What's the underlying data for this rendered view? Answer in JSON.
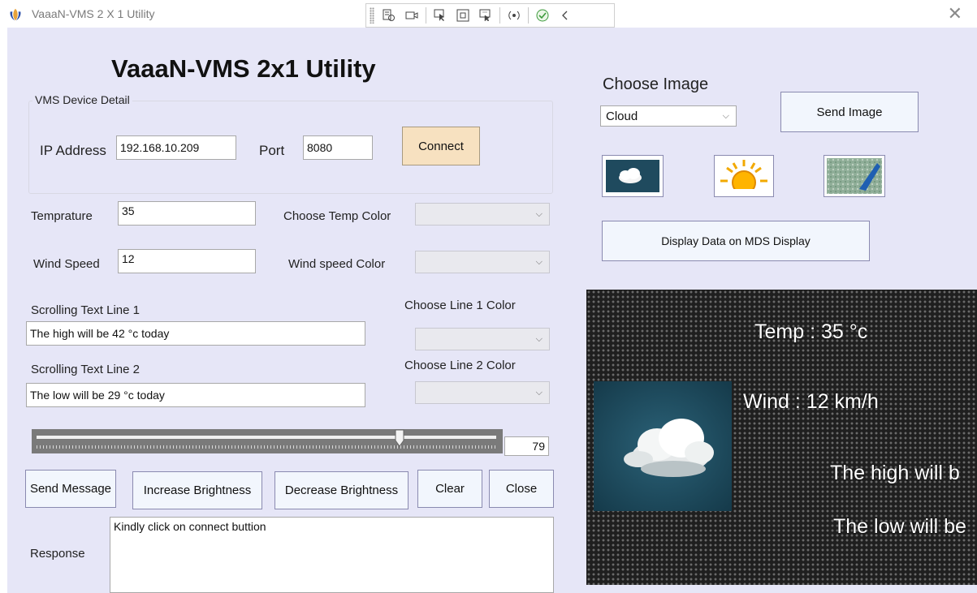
{
  "window": {
    "title": "VaaaN-VMS 2 X 1 Utility",
    "close_glyph": "✕"
  },
  "heading": "VaaaN-VMS 2x1 Utility",
  "device": {
    "group_label": "VMS Device Detail",
    "ip_label": "IP Address",
    "ip_value": "192.168.10.209",
    "port_label": "Port",
    "port_value": "8080",
    "connect_label": "Connect"
  },
  "fields": {
    "temp_label": "Temprature",
    "temp_value": "35",
    "temp_color_label": "Choose Temp Color",
    "wind_label": "Wind Speed",
    "wind_value": "12",
    "wind_color_label": "Wind speed Color",
    "line1_label": "Scrolling Text Line 1",
    "line1_value": "The high will be 42 °c today",
    "line1_color_label": "Choose Line 1 Color",
    "line2_label": "Scrolling Text Line 2",
    "line2_value": "The low will be 29 °c today",
    "line2_color_label": "Choose Line 2 Color"
  },
  "brightness": {
    "value": "79",
    "fraction": 0.79
  },
  "buttons": {
    "send_message": "Send Message",
    "increase_brightness": "Increase Brightness",
    "decrease_brightness": "Decrease Brightness",
    "clear": "Clear",
    "close": "Close"
  },
  "response": {
    "label": "Response",
    "text": "Kindly click on connect buttion"
  },
  "image_panel": {
    "title": "Choose Image",
    "selected": "Cloud",
    "send_label": "Send Image",
    "thumbnails": [
      "cloud-icon",
      "sun-icon",
      "rain-icon"
    ],
    "display_button": "Display Data on MDS Display"
  },
  "led_preview": {
    "temp_text": "Temp : 35 °c",
    "wind_text": "Wind : 12 km/h",
    "line1_text": "The high will b",
    "line2_text": "The low will be"
  },
  "colors": {
    "window_bg": "#e6e6f7",
    "connect_button": "#f7e1c0",
    "led_bg": "#1f1f1f"
  }
}
